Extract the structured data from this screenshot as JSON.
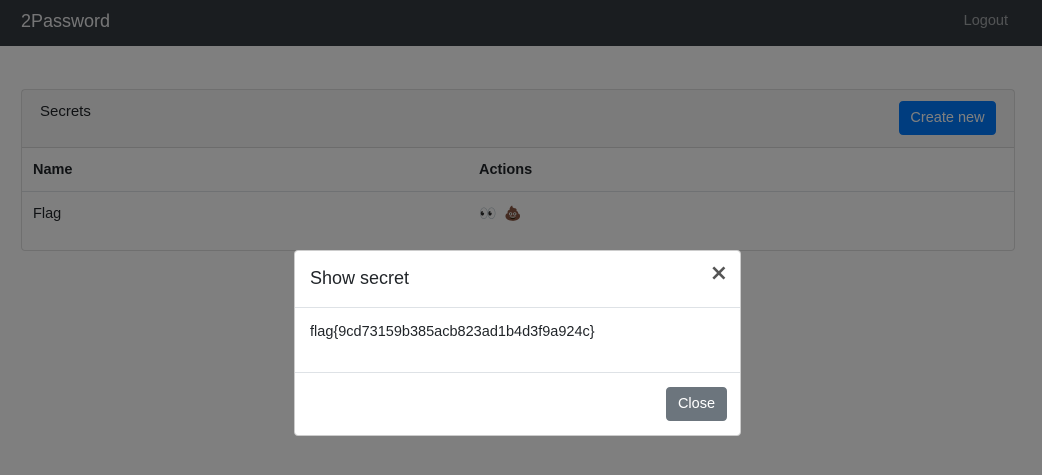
{
  "navbar": {
    "brand": "2Password",
    "logout_label": "Logout"
  },
  "card": {
    "title": "Secrets",
    "create_label": "Create new",
    "table": {
      "columns": [
        "Name",
        "Actions"
      ],
      "rows": [
        {
          "name": "Flag",
          "actions": [
            {
              "icon": "eyes-icon",
              "glyph": "👀"
            },
            {
              "icon": "poop-icon",
              "glyph": "💩"
            }
          ]
        }
      ]
    }
  },
  "modal": {
    "title": "Show secret",
    "close_glyph": "×",
    "secret": "flag{9cd73159b385acb823ad1b4d3f9a924c}",
    "close_label": "Close"
  }
}
